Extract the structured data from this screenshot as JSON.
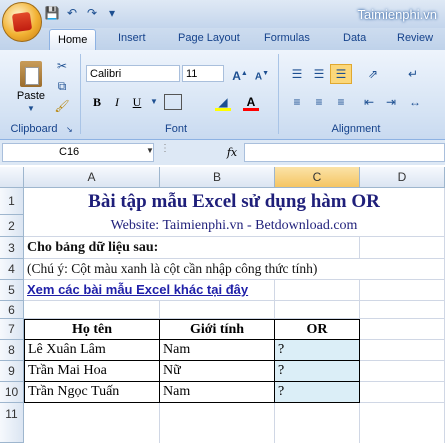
{
  "app": {
    "brand": "Taimienphi.vn"
  },
  "ribbon": {
    "tabs": [
      "Home",
      "Insert",
      "Page Layout",
      "Formulas",
      "Data",
      "Review"
    ],
    "clipboard": {
      "paste_label": "Paste",
      "group_label": "Clipboard"
    },
    "font": {
      "name": "Calibri",
      "size": "11",
      "group_label": "Font",
      "bold": "B",
      "italic": "I",
      "underline": "U"
    },
    "alignment": {
      "group_label": "Alignment"
    }
  },
  "formula_bar": {
    "name_box": "C16",
    "fx": "fx",
    "content": ""
  },
  "sheet": {
    "columns": [
      "A",
      "B",
      "C",
      "D"
    ],
    "selected_column": "C",
    "rows": [
      "1",
      "2",
      "3",
      "4",
      "5",
      "6",
      "7",
      "8",
      "9",
      "10",
      "11"
    ],
    "title": "Bài tập mẫu Excel sử dụng hàm OR",
    "website": "Website: Taimienphi.vn - Betdownload.com",
    "intro": "Cho bảng dữ liệu sau:",
    "note": "(Chú ý: Cột màu xanh là cột cần nhập công thức tính)",
    "link": "Xem các bài mẫu Excel khác tại đây",
    "table": {
      "headers": [
        "Họ tên",
        "Giới tính",
        "OR"
      ],
      "rows": [
        [
          "Lê Xuân Lâm",
          "Nam",
          "?"
        ],
        [
          "Trần Mai Hoa",
          "Nữ",
          "?"
        ],
        [
          "Trần Ngọc Tuấn",
          "Nam",
          "?"
        ]
      ]
    },
    "colors": {
      "input_fill": "#dbeef7",
      "link": "#1f1fa8"
    }
  },
  "watermark": "Taimienphi"
}
